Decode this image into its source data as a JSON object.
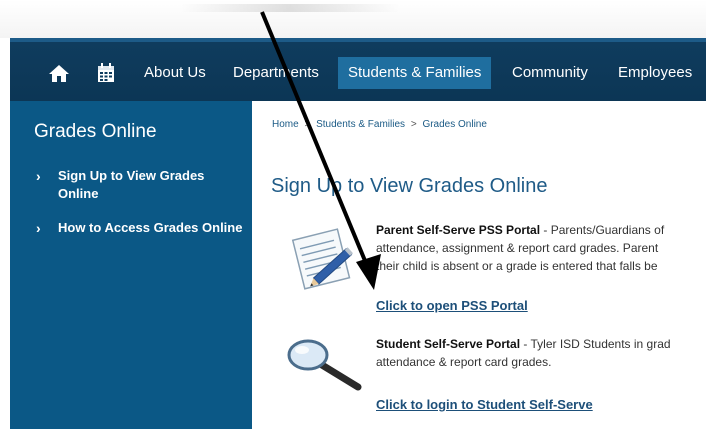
{
  "nav": {
    "home_icon": "home-icon",
    "calendar_icon": "calendar-icon",
    "items": [
      {
        "label": "About Us"
      },
      {
        "label": "Departments"
      },
      {
        "label": "Students & Families"
      },
      {
        "label": "Community"
      },
      {
        "label": "Employees"
      }
    ],
    "active_label": "Students & Families"
  },
  "sidebar": {
    "title": "Grades Online",
    "items": [
      {
        "label": "Sign Up to View Grades Online"
      },
      {
        "label": "How to Access Grades Online"
      }
    ]
  },
  "breadcrumb": {
    "items": [
      "Home",
      "Students & Families",
      "Grades Online"
    ],
    "separator": ">"
  },
  "main": {
    "title": "Sign Up to View Grades Online",
    "parent": {
      "name": "Parent Self-Serve PSS Portal",
      "lines": [
        "- Parents/Guardians of",
        "attendance, assignment & report card grades. Parent",
        "their child is absent or a grade is entered that falls be"
      ],
      "link": "Click to open PSS Portal"
    },
    "student": {
      "name": "Student Self-Serve Portal",
      "lines": [
        "- Tyler ISD Students in grad",
        "attendance & report card grades."
      ],
      "link": "Click to login to Student Self-Serve"
    }
  },
  "colors": {
    "navbar": "#0f3c5e",
    "nav_active": "#1f6e9f",
    "sidebar": "#0b5886",
    "title_blue": "#1f5b87",
    "link_blue": "#1d4f79"
  }
}
